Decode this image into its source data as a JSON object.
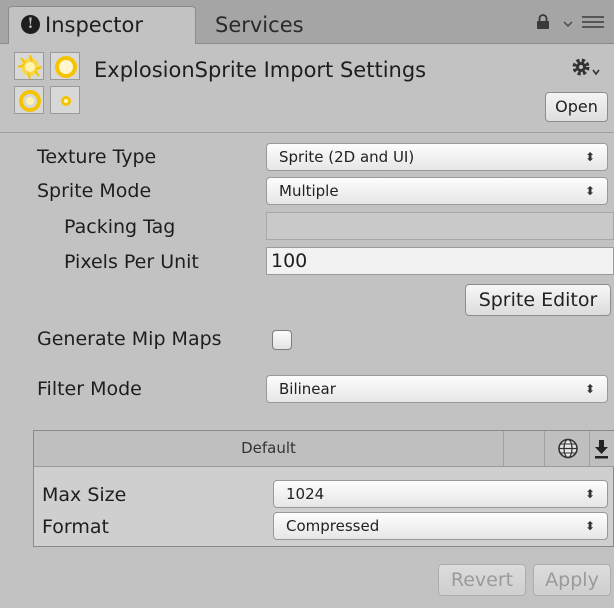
{
  "tabs": {
    "inspector": "Inspector",
    "services": "Services"
  },
  "header": {
    "title": "ExplosionSprite Import Settings",
    "open_label": "Open"
  },
  "properties": {
    "texture_type": {
      "label": "Texture Type",
      "value": "Sprite (2D and UI)"
    },
    "sprite_mode": {
      "label": "Sprite Mode",
      "value": "Multiple"
    },
    "packing_tag": {
      "label": "Packing Tag",
      "value": ""
    },
    "pixels_per_unit": {
      "label": "Pixels Per Unit",
      "value": "100"
    },
    "sprite_editor_label": "Sprite Editor",
    "generate_mip_maps": {
      "label": "Generate Mip Maps",
      "checked": false
    },
    "filter_mode": {
      "label": "Filter Mode",
      "value": "Bilinear"
    }
  },
  "platform": {
    "tab_default": "Default",
    "max_size": {
      "label": "Max Size",
      "value": "1024"
    },
    "format": {
      "label": "Format",
      "value": "Compressed"
    }
  },
  "footer": {
    "revert_label": "Revert",
    "apply_label": "Apply"
  },
  "icons": {
    "info": "info-icon",
    "lock": "lock-icon",
    "menu": "tab-menu-icon",
    "gear": "gear-icon",
    "globe": "globe-icon",
    "download": "download-icon",
    "dropdown": "dropdown-arrow-icon"
  },
  "colors": {
    "background": "#c2c2c2",
    "tabbar": "#a5a5a5",
    "sprite_yellow": "#f4c400"
  }
}
